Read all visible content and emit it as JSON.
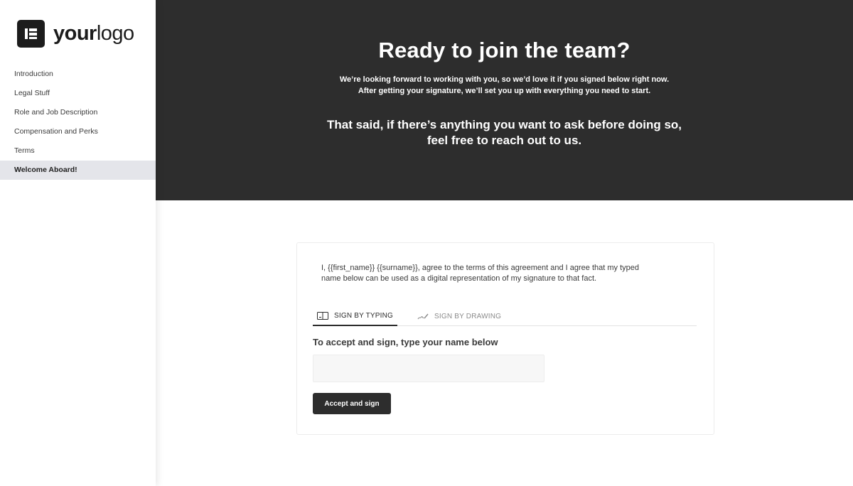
{
  "brand": {
    "logo_bold": "your",
    "logo_light": "logo"
  },
  "sidebar": {
    "items": [
      {
        "label": "Introduction",
        "active": false
      },
      {
        "label": "Legal Stuff",
        "active": false
      },
      {
        "label": "Role and Job Description",
        "active": false
      },
      {
        "label": "Compensation and Perks",
        "active": false
      },
      {
        "label": "Terms",
        "active": false
      },
      {
        "label": "Welcome Aboard!",
        "active": true
      }
    ]
  },
  "hero": {
    "title": "Ready to join the team?",
    "subtitle_line1": "We’re looking forward to working with you, so we’d love it if you signed below right now.",
    "subtitle_line2": "After getting your signature, we’ll set you up with everything you need to start.",
    "note_line1": "That said, if there’s anything you want to ask before doing so,",
    "note_line2": "feel free to reach out to us.",
    "background_color": "#2d2d2d"
  },
  "signature": {
    "agreement_line1": "I, {{first_name}} {{surname}}, agree to the terms of this agreement and I agree that my typed",
    "agreement_line2": "name below can be used as a digital representation of my signature to that fact.",
    "tabs": [
      {
        "label": "SIGN BY TYPING",
        "icon": "keyboard-icon",
        "active": true
      },
      {
        "label": "SIGN BY DRAWING",
        "icon": "signature-pen-icon",
        "active": false
      }
    ],
    "input_label": "To accept and sign, type your name below",
    "input_value": "",
    "input_placeholder": "",
    "button_label": "Accept and sign",
    "accent_color": "#2d2d2d"
  }
}
